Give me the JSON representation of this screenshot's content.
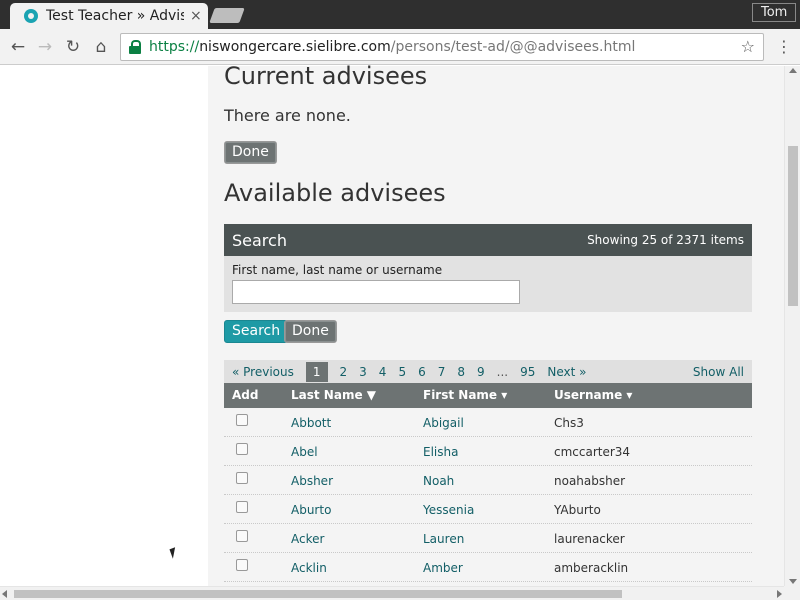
{
  "browser": {
    "tab_title": "Test Teacher » Advisees",
    "tab_close": "×",
    "profile_name": "Tom",
    "url_scheme": "https://",
    "url_host": "niswongercare.sielibre.com",
    "url_path": "/persons/test-ad/@@advisees.html",
    "icons": {
      "back": "←",
      "forward": "→",
      "reload": "↻",
      "home": "⌂",
      "star": "☆",
      "menu": "⋮"
    }
  },
  "current": {
    "heading": "Current advisees",
    "empty_text": "There are none.",
    "done_label": "Done"
  },
  "available": {
    "heading": "Available advisees",
    "search": {
      "title": "Search",
      "count_text": "Showing 25 of 2371 items",
      "field_label": "First name, last name or username",
      "field_value": "",
      "search_label": "Search",
      "done_label": "Done"
    },
    "pager": {
      "previous": "« Previous",
      "current_page": "1",
      "pages": [
        "2",
        "3",
        "4",
        "5",
        "6",
        "7",
        "8",
        "9"
      ],
      "ellipsis": "...",
      "last_page": "95",
      "next": "Next »",
      "show_all": "Show All"
    },
    "table": {
      "headers": {
        "add": "Add",
        "last_name": "Last Name ▼",
        "first_name": "First Name ▾",
        "username": "Username ▾"
      },
      "rows": [
        {
          "last": "Abbott",
          "first": "Abigail",
          "username": "Chs3"
        },
        {
          "last": "Abel",
          "first": "Elisha",
          "username": "cmccarter34"
        },
        {
          "last": "Absher",
          "first": "Noah",
          "username": "noahabsher"
        },
        {
          "last": "Aburto",
          "first": "Yessenia",
          "username": "YAburto"
        },
        {
          "last": "Acker",
          "first": "Lauren",
          "username": "laurenacker"
        },
        {
          "last": "Acklin",
          "first": "Amber",
          "username": "amberacklin"
        }
      ]
    }
  },
  "colors": {
    "accent": "#1e9aa5",
    "link": "#125e66",
    "header_dark": "#4a5252",
    "secure_green": "#0b8043"
  }
}
